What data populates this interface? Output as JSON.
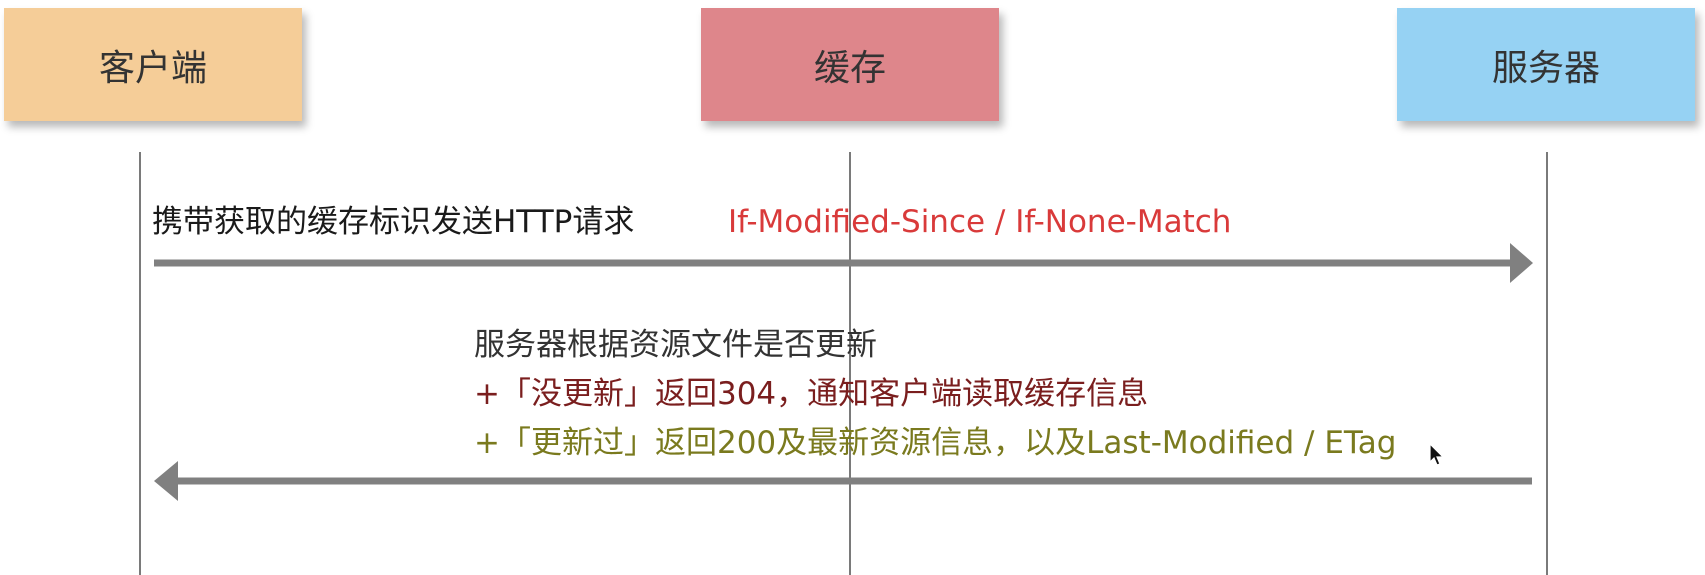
{
  "participants": {
    "client": {
      "label": "客户端",
      "color": "#f5cd98"
    },
    "cache": {
      "label": "缓存",
      "color": "#de868b"
    },
    "server": {
      "label": "服务器",
      "color": "#96d2f3"
    }
  },
  "request": {
    "label": "携带获取的缓存标识发送HTTP请求",
    "headers": "If-Modified-Since / If-None-Match",
    "headers_color": "#d93a3a"
  },
  "response": {
    "line_1": "服务器根据资源文件是否更新",
    "line_2": "+「没更新」返回304，通知客户端读取缓存信息",
    "line_3": "+「更新过」返回200及最新资源信息，以及Last-Modified / ETag",
    "line_2_color": "#7a1e1e",
    "line_3_color": "#7a7a1e"
  },
  "arrow_color": "#808080",
  "cursor_icon": "mouse-pointer-icon"
}
